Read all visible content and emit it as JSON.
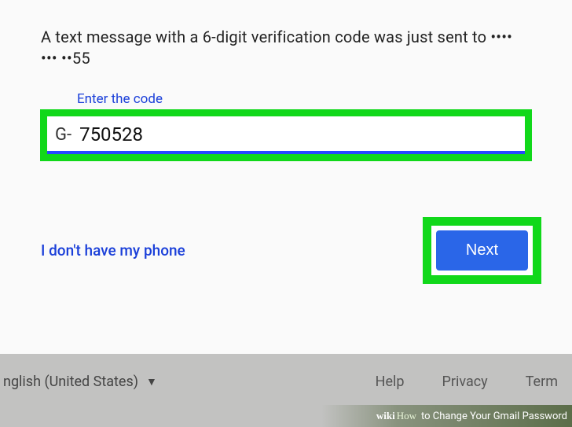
{
  "instruction": "A text message with a 6-digit verification code was just sent to •••• ••• ••55",
  "field": {
    "label": "Enter the code",
    "prefix": "G-",
    "value": "750528"
  },
  "actions": {
    "alt_link": "I don't have my phone",
    "next_label": "Next"
  },
  "footer": {
    "language": "nglish (United States)",
    "links": [
      "Help",
      "Privacy",
      "Term"
    ]
  },
  "watermark": {
    "brand_a": "wiki",
    "brand_b": "How",
    "title": " to Change Your Gmail Password"
  }
}
